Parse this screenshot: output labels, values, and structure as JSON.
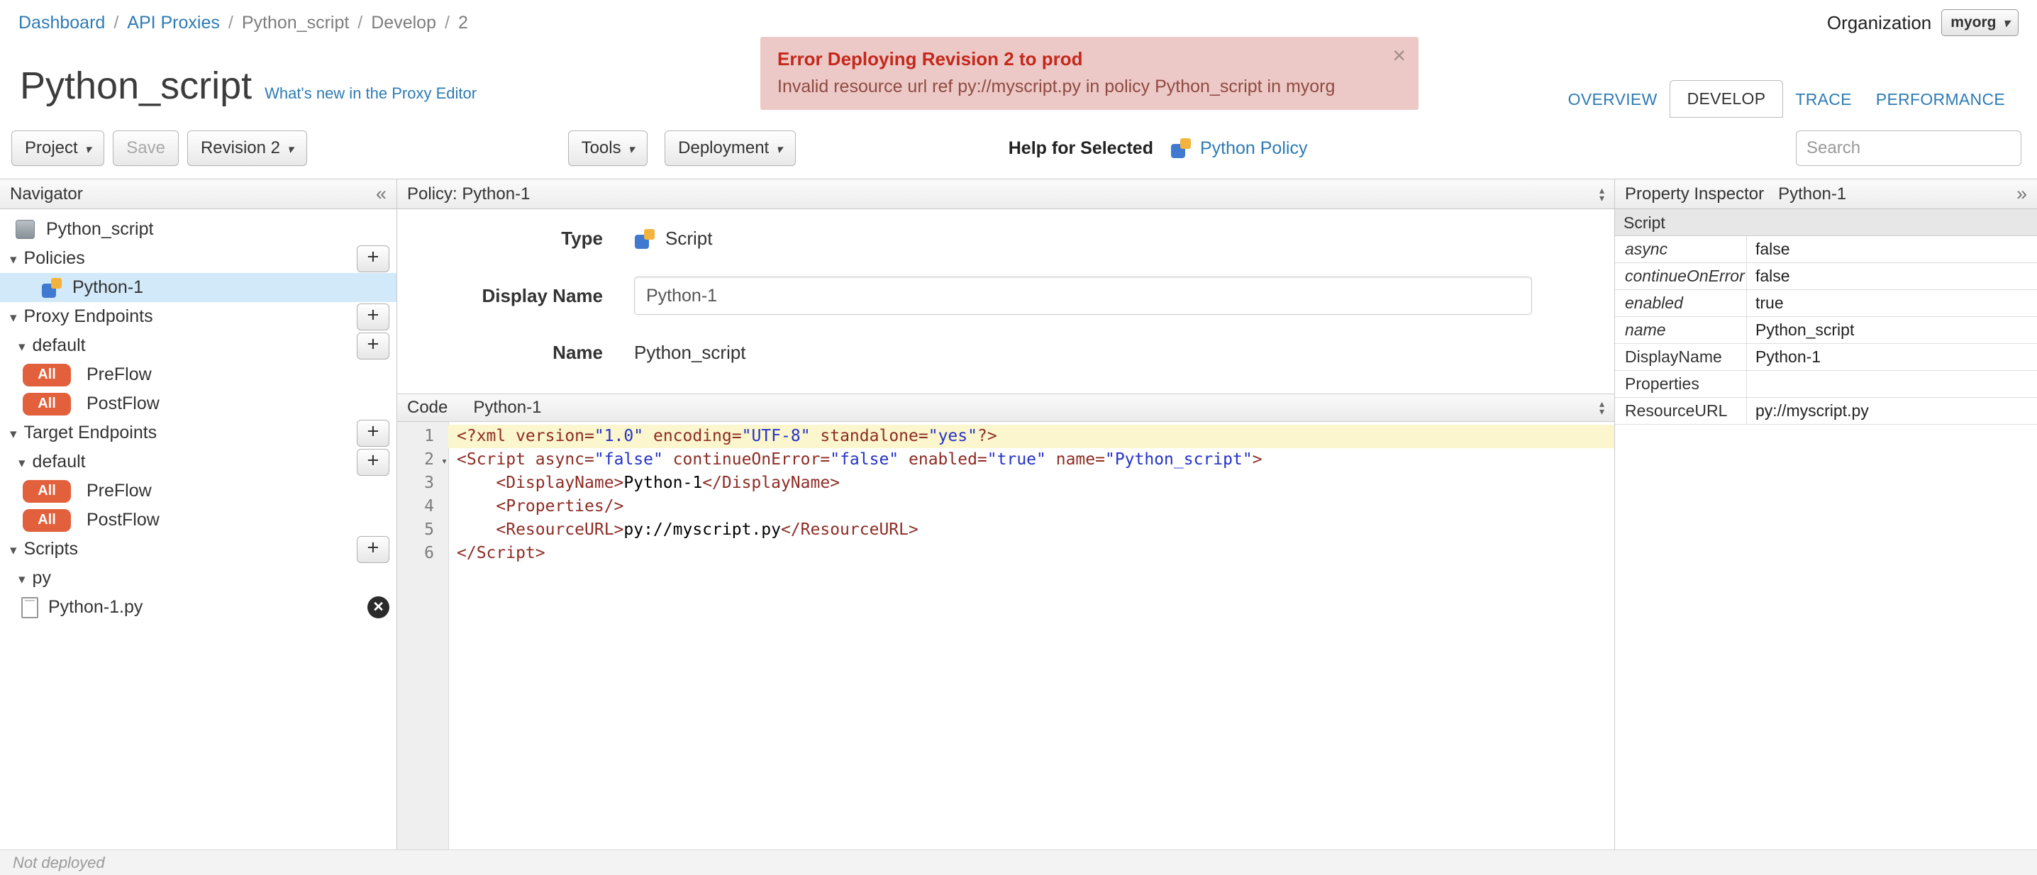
{
  "colors": {
    "link_blue": "#2e7bb4",
    "error_banner_bg": "#ecc9c6",
    "error_title_red": "#c5271c",
    "badge_orange": "#e2603c",
    "selected_row_blue": "#d2e9f9",
    "code_highlight_yellow": "#fbf6cd",
    "syntax_tag": "#8d2c24",
    "syntax_string": "#2433c8"
  },
  "breadcrumb": {
    "separator": "/",
    "items": [
      "Dashboard",
      "API Proxies",
      "Python_script",
      "Develop",
      "2"
    ]
  },
  "organization": {
    "label": "Organization",
    "value": "myorg"
  },
  "error_banner": {
    "title": "Error Deploying Revision 2 to prod",
    "message": "Invalid resource url ref py://myscript.py in policy Python_script in myorg"
  },
  "page": {
    "title": "Python_script",
    "whats_new": "What's new in the Proxy Editor"
  },
  "tabs": [
    {
      "label": "OVERVIEW",
      "active": false
    },
    {
      "label": "DEVELOP",
      "active": true
    },
    {
      "label": "TRACE",
      "active": false
    },
    {
      "label": "PERFORMANCE",
      "active": false
    }
  ],
  "toolbar": {
    "project": "Project",
    "save": "Save",
    "revision": "Revision 2",
    "tools": "Tools",
    "deployment": "Deployment",
    "help_for_selected": "Help for Selected",
    "help_link": "Python Policy",
    "search_placeholder": "Search"
  },
  "navigator": {
    "header": "Navigator",
    "badge": "All",
    "items": {
      "root": "Python_script",
      "policies": "Policies",
      "policy1": "Python-1",
      "proxy_endpoints": "Proxy Endpoints",
      "proxy_default": "default",
      "preflow": "PreFlow",
      "postflow": "PostFlow",
      "target_endpoints": "Target Endpoints",
      "target_default": "default",
      "scripts": "Scripts",
      "py_folder": "py",
      "file": "Python-1.py"
    }
  },
  "policy": {
    "header": "Policy: Python-1",
    "type_label": "Type",
    "type_value": "Script",
    "display_name_label": "Display Name",
    "display_name_value": "Python-1",
    "name_label": "Name",
    "name_value": "Python_script"
  },
  "code": {
    "label": "Code",
    "name": "Python-1",
    "lines": [
      {
        "num": 1,
        "highlight": true,
        "fold": false,
        "tokens": [
          [
            "tag",
            "<?xml version="
          ],
          [
            "str",
            "\"1.0\""
          ],
          [
            "tag",
            " encoding="
          ],
          [
            "str",
            "\"UTF-8\""
          ],
          [
            "tag",
            " standalone="
          ],
          [
            "str",
            "\"yes\""
          ],
          [
            "tag",
            "?>"
          ]
        ]
      },
      {
        "num": 2,
        "highlight": false,
        "fold": true,
        "tokens": [
          [
            "tag",
            "<Script async="
          ],
          [
            "str",
            "\"false\""
          ],
          [
            "tag",
            " continueOnError="
          ],
          [
            "str",
            "\"false\""
          ],
          [
            "tag",
            " enabled="
          ],
          [
            "str",
            "\"true\""
          ],
          [
            "tag",
            " name="
          ],
          [
            "str",
            "\"Python_script\""
          ],
          [
            "tag",
            ">"
          ]
        ]
      },
      {
        "num": 3,
        "highlight": false,
        "fold": false,
        "tokens": [
          [
            "text",
            "    "
          ],
          [
            "tag",
            "<DisplayName>"
          ],
          [
            "text",
            "Python-1"
          ],
          [
            "tag",
            "</DisplayName>"
          ]
        ]
      },
      {
        "num": 4,
        "highlight": false,
        "fold": false,
        "tokens": [
          [
            "text",
            "    "
          ],
          [
            "tag",
            "<Properties/>"
          ]
        ]
      },
      {
        "num": 5,
        "highlight": false,
        "fold": false,
        "tokens": [
          [
            "text",
            "    "
          ],
          [
            "tag",
            "<ResourceURL>"
          ],
          [
            "text",
            "py://myscript.py"
          ],
          [
            "tag",
            "</ResourceURL>"
          ]
        ]
      },
      {
        "num": 6,
        "highlight": false,
        "fold": false,
        "tokens": [
          [
            "tag",
            "</Script>"
          ]
        ]
      }
    ]
  },
  "inspector": {
    "header": "Property Inspector",
    "context": "Python-1",
    "section": "Script",
    "rows": [
      {
        "key": "async",
        "value": "false",
        "italic": true
      },
      {
        "key": "continueOnError",
        "value": "false",
        "italic": true
      },
      {
        "key": "enabled",
        "value": "true",
        "italic": true
      },
      {
        "key": "name",
        "value": "Python_script",
        "italic": true
      },
      {
        "key": "DisplayName",
        "value": "Python-1",
        "italic": false
      },
      {
        "key": "Properties",
        "value": "",
        "italic": false
      },
      {
        "key": "ResourceURL",
        "value": "py://myscript.py",
        "italic": false
      }
    ]
  },
  "status_bar": {
    "text": "Not deployed"
  }
}
